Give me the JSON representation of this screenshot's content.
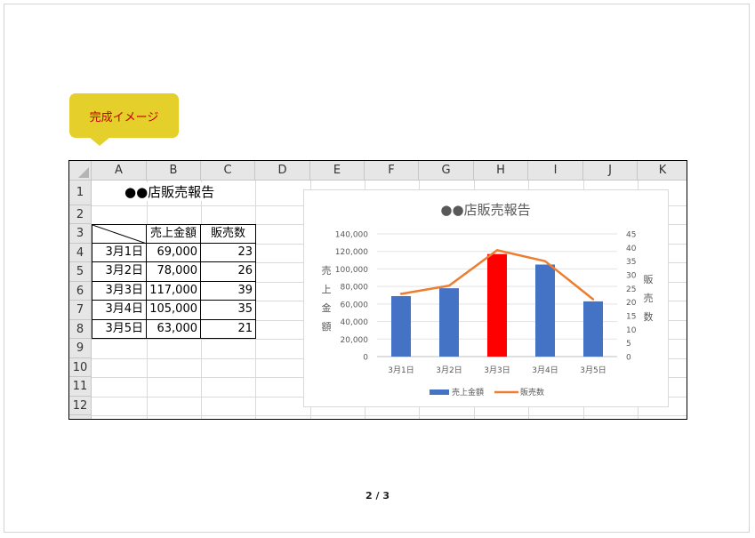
{
  "callout": {
    "text": "完成イメージ"
  },
  "sheet": {
    "columns": [
      "A",
      "B",
      "C",
      "D",
      "E",
      "F",
      "G",
      "H",
      "I",
      "J",
      "K"
    ],
    "rows": [
      "1",
      "2",
      "3",
      "4",
      "5",
      "6",
      "7",
      "8",
      "9",
      "10",
      "11",
      "12"
    ],
    "title": "●●店販売報告",
    "table": {
      "headers": [
        "売上金額",
        "販売数"
      ],
      "rows": [
        {
          "date": "3月1日",
          "sales": "69,000",
          "count": "23"
        },
        {
          "date": "3月2日",
          "sales": "78,000",
          "count": "26"
        },
        {
          "date": "3月3日",
          "sales": "117,000",
          "count": "39"
        },
        {
          "date": "3月4日",
          "sales": "105,000",
          "count": "35"
        },
        {
          "date": "3月5日",
          "sales": "63,000",
          "count": "21"
        }
      ]
    }
  },
  "chart_data": {
    "type": "bar",
    "title": "●●店販売報告",
    "categories": [
      "3月1日",
      "3月2日",
      "3月3日",
      "3月4日",
      "3月5日"
    ],
    "series": [
      {
        "name": "売上金額",
        "type": "bar",
        "axis": "left",
        "values": [
          69000,
          78000,
          117000,
          105000,
          63000
        ],
        "color": "#4472c4",
        "highlight": {
          "index": 2,
          "color": "#ff0000"
        }
      },
      {
        "name": "販売数",
        "type": "line",
        "axis": "right",
        "values": [
          23,
          26,
          39,
          35,
          21
        ],
        "color": "#ed7d31"
      }
    ],
    "ylabel": "売上金額",
    "y2label": "販売数",
    "ylim": [
      0,
      140000
    ],
    "y2lim": [
      0,
      45
    ],
    "yticks": [
      "0",
      "20,000",
      "40,000",
      "60,000",
      "80,000",
      "100,000",
      "120,000",
      "140,000"
    ],
    "y2ticks": [
      "0",
      "5",
      "10",
      "15",
      "20",
      "25",
      "30",
      "35",
      "40",
      "45"
    ],
    "legend": "bottom",
    "grid": true
  },
  "footer": {
    "page": "2 / 3"
  }
}
